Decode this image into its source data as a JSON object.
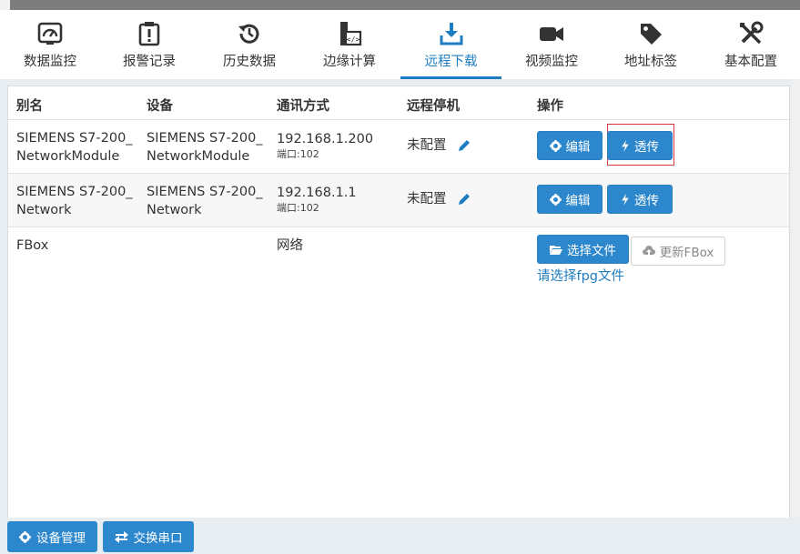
{
  "tabs": [
    {
      "label": "数据监控",
      "icon": "gauge-icon"
    },
    {
      "label": "报警记录",
      "icon": "alarm-clipboard-icon"
    },
    {
      "label": "历史数据",
      "icon": "history-icon"
    },
    {
      "label": "边缘计算",
      "icon": "code-file-icon"
    },
    {
      "label": "远程下载",
      "icon": "download-icon"
    },
    {
      "label": "视频监控",
      "icon": "video-camera-icon"
    },
    {
      "label": "地址标签",
      "icon": "tag-icon"
    },
    {
      "label": "基本配置",
      "icon": "tools-icon"
    }
  ],
  "active_tab": "远程下载",
  "table": {
    "headers": {
      "alias": "别名",
      "device": "设备",
      "comm": "通讯方式",
      "remote_stop": "远程停机",
      "ops": "操作"
    },
    "rows": [
      {
        "alias_l1": "SIEMENS S7-200_",
        "alias_l2": "NetworkModule",
        "device_l1": "SIEMENS S7-200_",
        "device_l2": "NetworkModule",
        "ip": "192.168.1.200",
        "port": "端口:102",
        "stop": "未配置",
        "edit": "编辑",
        "pass": "透传"
      },
      {
        "alias_l1": "SIEMENS S7-200_",
        "alias_l2": "Network",
        "device_l1": "SIEMENS S7-200_",
        "device_l2": "Network",
        "ip": "192.168.1.1",
        "port": "端口:102",
        "stop": "未配置",
        "edit": "编辑",
        "pass": "透传"
      }
    ],
    "fbox_row": {
      "alias": "FBox",
      "comm": "网络",
      "select_file": "选择文件",
      "update": "更新FBox",
      "hint": "请选择fpg文件"
    }
  },
  "bottom": {
    "device_mgmt": "设备管理",
    "swap_port": "交换串口"
  },
  "colors": {
    "accent": "#1e7dc1",
    "button": "#2d87cc",
    "highlight": "#d9343a"
  }
}
